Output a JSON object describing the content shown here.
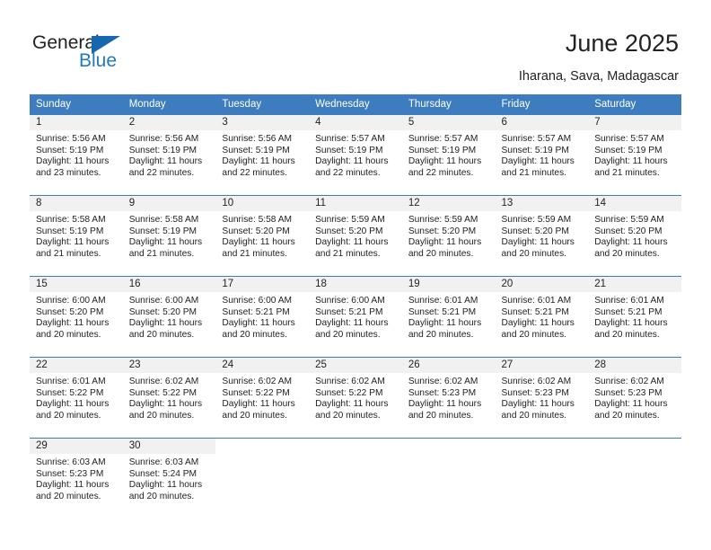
{
  "brand": {
    "name_part1": "General",
    "name_part2": "Blue",
    "logo_icon": "triangle-logo-icon"
  },
  "header": {
    "title": "June 2025",
    "location": "Iharana, Sava, Madagascar"
  },
  "colors": {
    "header_blue": "#3d7dbf",
    "brand_blue": "#1f7bc1",
    "daynum_band": "#f1f1f1",
    "text": "#222222"
  },
  "weekday_headers": [
    "Sunday",
    "Monday",
    "Tuesday",
    "Wednesday",
    "Thursday",
    "Friday",
    "Saturday"
  ],
  "weeks": [
    [
      {
        "day": "1",
        "sunrise": "Sunrise: 5:56 AM",
        "sunset": "Sunset: 5:19 PM",
        "daylight1": "Daylight: 11 hours",
        "daylight2": "and 23 minutes."
      },
      {
        "day": "2",
        "sunrise": "Sunrise: 5:56 AM",
        "sunset": "Sunset: 5:19 PM",
        "daylight1": "Daylight: 11 hours",
        "daylight2": "and 22 minutes."
      },
      {
        "day": "3",
        "sunrise": "Sunrise: 5:56 AM",
        "sunset": "Sunset: 5:19 PM",
        "daylight1": "Daylight: 11 hours",
        "daylight2": "and 22 minutes."
      },
      {
        "day": "4",
        "sunrise": "Sunrise: 5:57 AM",
        "sunset": "Sunset: 5:19 PM",
        "daylight1": "Daylight: 11 hours",
        "daylight2": "and 22 minutes."
      },
      {
        "day": "5",
        "sunrise": "Sunrise: 5:57 AM",
        "sunset": "Sunset: 5:19 PM",
        "daylight1": "Daylight: 11 hours",
        "daylight2": "and 22 minutes."
      },
      {
        "day": "6",
        "sunrise": "Sunrise: 5:57 AM",
        "sunset": "Sunset: 5:19 PM",
        "daylight1": "Daylight: 11 hours",
        "daylight2": "and 21 minutes."
      },
      {
        "day": "7",
        "sunrise": "Sunrise: 5:57 AM",
        "sunset": "Sunset: 5:19 PM",
        "daylight1": "Daylight: 11 hours",
        "daylight2": "and 21 minutes."
      }
    ],
    [
      {
        "day": "8",
        "sunrise": "Sunrise: 5:58 AM",
        "sunset": "Sunset: 5:19 PM",
        "daylight1": "Daylight: 11 hours",
        "daylight2": "and 21 minutes."
      },
      {
        "day": "9",
        "sunrise": "Sunrise: 5:58 AM",
        "sunset": "Sunset: 5:19 PM",
        "daylight1": "Daylight: 11 hours",
        "daylight2": "and 21 minutes."
      },
      {
        "day": "10",
        "sunrise": "Sunrise: 5:58 AM",
        "sunset": "Sunset: 5:20 PM",
        "daylight1": "Daylight: 11 hours",
        "daylight2": "and 21 minutes."
      },
      {
        "day": "11",
        "sunrise": "Sunrise: 5:59 AM",
        "sunset": "Sunset: 5:20 PM",
        "daylight1": "Daylight: 11 hours",
        "daylight2": "and 21 minutes."
      },
      {
        "day": "12",
        "sunrise": "Sunrise: 5:59 AM",
        "sunset": "Sunset: 5:20 PM",
        "daylight1": "Daylight: 11 hours",
        "daylight2": "and 20 minutes."
      },
      {
        "day": "13",
        "sunrise": "Sunrise: 5:59 AM",
        "sunset": "Sunset: 5:20 PM",
        "daylight1": "Daylight: 11 hours",
        "daylight2": "and 20 minutes."
      },
      {
        "day": "14",
        "sunrise": "Sunrise: 5:59 AM",
        "sunset": "Sunset: 5:20 PM",
        "daylight1": "Daylight: 11 hours",
        "daylight2": "and 20 minutes."
      }
    ],
    [
      {
        "day": "15",
        "sunrise": "Sunrise: 6:00 AM",
        "sunset": "Sunset: 5:20 PM",
        "daylight1": "Daylight: 11 hours",
        "daylight2": "and 20 minutes."
      },
      {
        "day": "16",
        "sunrise": "Sunrise: 6:00 AM",
        "sunset": "Sunset: 5:20 PM",
        "daylight1": "Daylight: 11 hours",
        "daylight2": "and 20 minutes."
      },
      {
        "day": "17",
        "sunrise": "Sunrise: 6:00 AM",
        "sunset": "Sunset: 5:21 PM",
        "daylight1": "Daylight: 11 hours",
        "daylight2": "and 20 minutes."
      },
      {
        "day": "18",
        "sunrise": "Sunrise: 6:00 AM",
        "sunset": "Sunset: 5:21 PM",
        "daylight1": "Daylight: 11 hours",
        "daylight2": "and 20 minutes."
      },
      {
        "day": "19",
        "sunrise": "Sunrise: 6:01 AM",
        "sunset": "Sunset: 5:21 PM",
        "daylight1": "Daylight: 11 hours",
        "daylight2": "and 20 minutes."
      },
      {
        "day": "20",
        "sunrise": "Sunrise: 6:01 AM",
        "sunset": "Sunset: 5:21 PM",
        "daylight1": "Daylight: 11 hours",
        "daylight2": "and 20 minutes."
      },
      {
        "day": "21",
        "sunrise": "Sunrise: 6:01 AM",
        "sunset": "Sunset: 5:21 PM",
        "daylight1": "Daylight: 11 hours",
        "daylight2": "and 20 minutes."
      }
    ],
    [
      {
        "day": "22",
        "sunrise": "Sunrise: 6:01 AM",
        "sunset": "Sunset: 5:22 PM",
        "daylight1": "Daylight: 11 hours",
        "daylight2": "and 20 minutes."
      },
      {
        "day": "23",
        "sunrise": "Sunrise: 6:02 AM",
        "sunset": "Sunset: 5:22 PM",
        "daylight1": "Daylight: 11 hours",
        "daylight2": "and 20 minutes."
      },
      {
        "day": "24",
        "sunrise": "Sunrise: 6:02 AM",
        "sunset": "Sunset: 5:22 PM",
        "daylight1": "Daylight: 11 hours",
        "daylight2": "and 20 minutes."
      },
      {
        "day": "25",
        "sunrise": "Sunrise: 6:02 AM",
        "sunset": "Sunset: 5:22 PM",
        "daylight1": "Daylight: 11 hours",
        "daylight2": "and 20 minutes."
      },
      {
        "day": "26",
        "sunrise": "Sunrise: 6:02 AM",
        "sunset": "Sunset: 5:23 PM",
        "daylight1": "Daylight: 11 hours",
        "daylight2": "and 20 minutes."
      },
      {
        "day": "27",
        "sunrise": "Sunrise: 6:02 AM",
        "sunset": "Sunset: 5:23 PM",
        "daylight1": "Daylight: 11 hours",
        "daylight2": "and 20 minutes."
      },
      {
        "day": "28",
        "sunrise": "Sunrise: 6:02 AM",
        "sunset": "Sunset: 5:23 PM",
        "daylight1": "Daylight: 11 hours",
        "daylight2": "and 20 minutes."
      }
    ],
    [
      {
        "day": "29",
        "sunrise": "Sunrise: 6:03 AM",
        "sunset": "Sunset: 5:23 PM",
        "daylight1": "Daylight: 11 hours",
        "daylight2": "and 20 minutes."
      },
      {
        "day": "30",
        "sunrise": "Sunrise: 6:03 AM",
        "sunset": "Sunset: 5:24 PM",
        "daylight1": "Daylight: 11 hours",
        "daylight2": "and 20 minutes."
      },
      {
        "day": "",
        "sunrise": "",
        "sunset": "",
        "daylight1": "",
        "daylight2": ""
      },
      {
        "day": "",
        "sunrise": "",
        "sunset": "",
        "daylight1": "",
        "daylight2": ""
      },
      {
        "day": "",
        "sunrise": "",
        "sunset": "",
        "daylight1": "",
        "daylight2": ""
      },
      {
        "day": "",
        "sunrise": "",
        "sunset": "",
        "daylight1": "",
        "daylight2": ""
      },
      {
        "day": "",
        "sunrise": "",
        "sunset": "",
        "daylight1": "",
        "daylight2": ""
      }
    ]
  ]
}
